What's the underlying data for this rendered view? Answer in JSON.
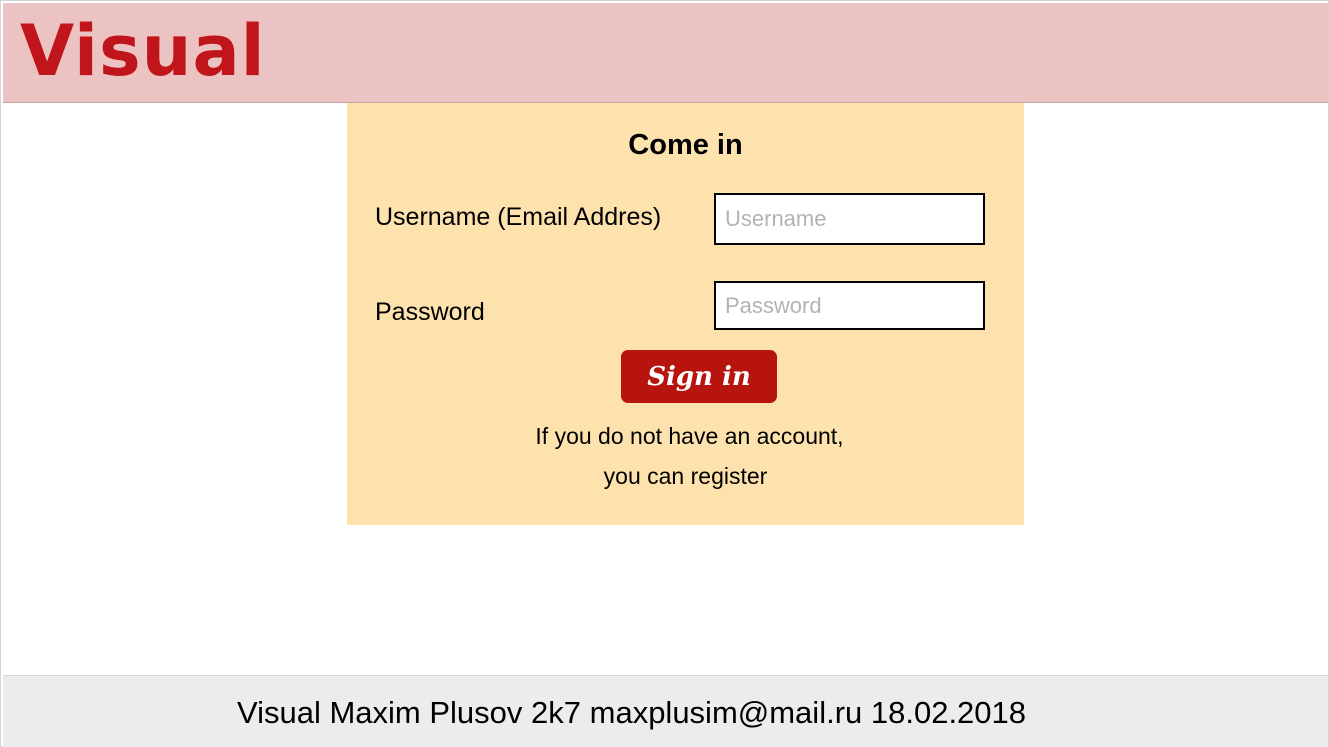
{
  "header": {
    "logo_text": "Visual",
    "background_color": "#ecc3c3",
    "logo_color": "#c0151a"
  },
  "login": {
    "title": "Come in",
    "username_label": "Username (Email Addres)",
    "username_placeholder": "Username",
    "username_value": "",
    "password_label": "Password",
    "password_placeholder": "Password",
    "password_value": "",
    "submit_label": "Sign in",
    "register_line1": "If you do not have an account,",
    "register_line2": "you can register",
    "card_color": "#fde2ad",
    "button_color": "#b8140e"
  },
  "footer": {
    "text": "Visual Maxim Plusov 2k7 maxplusim@mail.ru 18.02.2018"
  }
}
